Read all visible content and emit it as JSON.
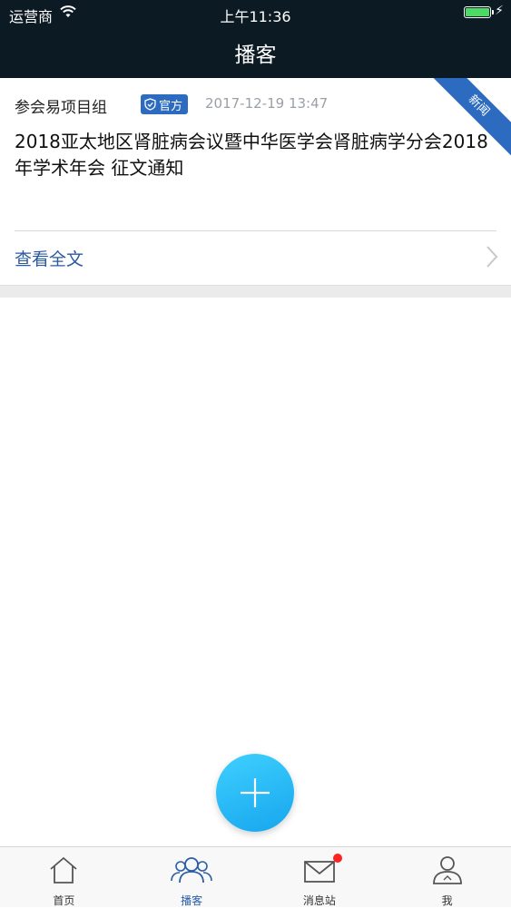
{
  "status_bar": {
    "carrier": "运营商",
    "time": "上午11:36"
  },
  "nav": {
    "title": "播客"
  },
  "post": {
    "author": "参会易项目组",
    "badge": "官方",
    "date": "2017-12-19 13:47",
    "ribbon": "新闻",
    "headline": "2018亚太地区肾脏病会议暨中华医学会肾脏病学分会2018年学术年会 征文通知",
    "read_more": "查看全文"
  },
  "tabs": [
    {
      "label": "首页",
      "icon": "home-icon"
    },
    {
      "label": "播客",
      "icon": "people-icon"
    },
    {
      "label": "消息站",
      "icon": "mail-icon"
    },
    {
      "label": "我",
      "icon": "user-icon"
    }
  ],
  "colors": {
    "nav_bg": "#0c1a24",
    "accent": "#2c6bbf",
    "fab": "#1fb6f5",
    "badge_dot": "#ff2222"
  }
}
